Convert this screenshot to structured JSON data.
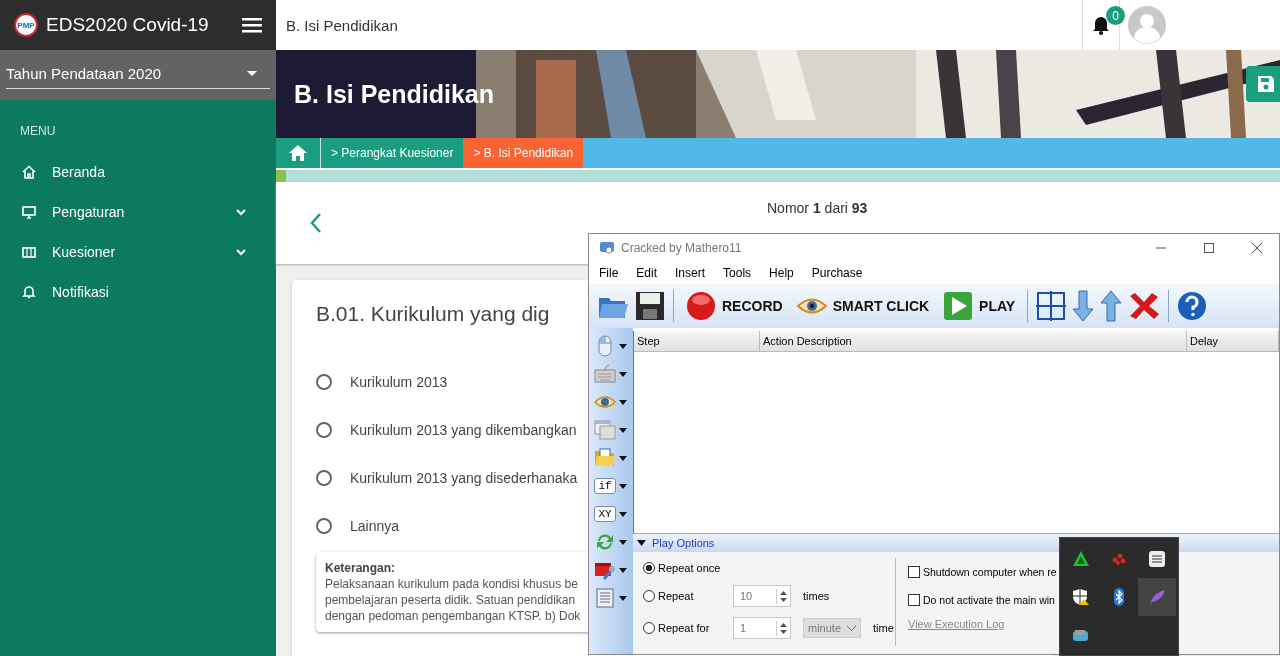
{
  "sidebar": {
    "brand": "EDS2020 Covid-19",
    "logo_text": "PMP",
    "year_select": "Tahun Pendataan 2020",
    "menu_label": "MENU",
    "items": [
      {
        "label": "Beranda",
        "kind": "home",
        "has_submenu": false
      },
      {
        "label": "Pengaturan",
        "kind": "monitor",
        "has_submenu": true
      },
      {
        "label": "Kuesioner",
        "kind": "ticket",
        "has_submenu": true
      },
      {
        "label": "Notifikasi",
        "kind": "bell",
        "has_submenu": false
      }
    ]
  },
  "topbar": {
    "page_title": "B. Isi Pendidikan",
    "notification_count": "0"
  },
  "banner": {
    "title": "B. Isi Pendidikan"
  },
  "progress": {
    "level": 0.01
  },
  "breadcrumb": [
    {
      "label": "> Perangkat Kuesioner",
      "selected": false
    },
    {
      "label": "> B. Isi Pendidikan",
      "selected": true
    }
  ],
  "pager": {
    "text": "Nomor **1** dari **93**"
  },
  "question": {
    "title": "B.01. Kurikulum yang dig",
    "options": [
      {
        "label": "Kurikulum 2013",
        "selected": false
      },
      {
        "label": "Kurikulum 2013 yang dikembangkan",
        "selected": false
      },
      {
        "label": "Kurikulum 2013 yang disederhanaka",
        "selected": false
      },
      {
        "label": "Lainnya",
        "selected": false
      }
    ],
    "note_label": "Keterangan:",
    "note_lines": [
      "Pelaksanaan kurikulum pada kondisi khusus be",
      "pembelajaran peserta didik. Satuan pendidikan",
      "dengan pedoman pengembangan KTSP. b) Dok"
    ]
  },
  "macro_window": {
    "title": "Cracked by Mathero11",
    "menu": [
      "File",
      "Edit",
      "Insert",
      "Tools",
      "Help",
      "Purchase"
    ],
    "toolbar": {
      "record": "RECORD",
      "smart_click": "SMART CLICK",
      "play": "PLAY"
    },
    "side_tools": [
      {
        "kind": "mouse"
      },
      {
        "kind": "keyboard"
      },
      {
        "kind": "eye"
      },
      {
        "kind": "window"
      },
      {
        "kind": "folder"
      },
      {
        "kind": "text",
        "label": "if"
      },
      {
        "kind": "text",
        "label": "XY"
      },
      {
        "kind": "refresh"
      },
      {
        "kind": "tools"
      },
      {
        "kind": "script"
      }
    ],
    "columns": [
      "Step",
      "Action Description",
      "Delay"
    ],
    "play_options": {
      "header": "Play Options",
      "expanded": true,
      "repeat": [
        {
          "label": "Repeat once",
          "selected": true
        },
        {
          "label": "Repeat",
          "selected": false,
          "value": "10",
          "unit": "times"
        },
        {
          "label": "Repeat for",
          "selected": false,
          "value": "1",
          "dropdown": "minute",
          "unit": "time"
        }
      ],
      "checks": [
        {
          "label": "Shutdown computer when re",
          "checked": false
        },
        {
          "label": "Do not activate the main win",
          "checked": false
        }
      ],
      "link": "View Execution Log"
    }
  },
  "tray": [
    {
      "kind": "triangle",
      "selected": false
    },
    {
      "kind": "dots",
      "selected": false
    },
    {
      "kind": "sliders",
      "selected": false
    },
    {
      "kind": "shield",
      "selected": false
    },
    {
      "kind": "bluetooth",
      "selected": false
    },
    {
      "kind": "feather",
      "selected": true
    },
    {
      "kind": "drive",
      "selected": false
    }
  ]
}
